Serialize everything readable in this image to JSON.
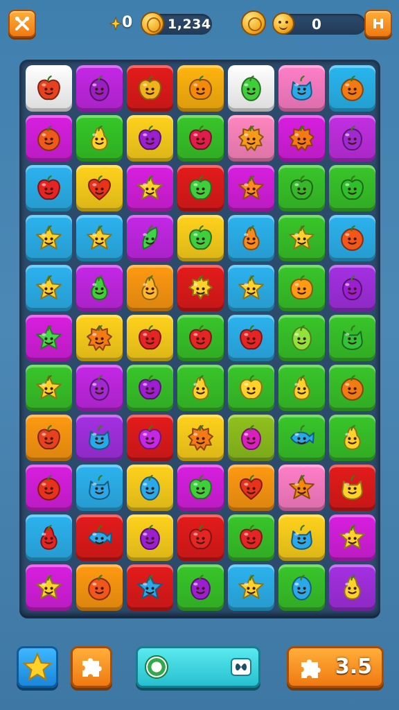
{
  "hud": {
    "menu_icon": "crossed-tools-icon",
    "star_counter": "0",
    "coin_balance": "1,234",
    "score_icon": "sun-badge-icon",
    "score_value": "0",
    "pause_icon": "pause-icon"
  },
  "board": {
    "columns": 7,
    "rows": 11,
    "tiles": [
      [
        {
          "c": "#ffffff",
          "f": "apple",
          "k": "#e8411f"
        },
        {
          "c": "#c428e6",
          "f": "plum",
          "k": "#9a1fc0"
        },
        {
          "c": "#e41b1b",
          "f": "apple",
          "k": "#f0b31c"
        },
        {
          "c": "#ffb40f",
          "f": "pumpkin",
          "k": "#f58a0a"
        },
        {
          "c": "#ffffff",
          "f": "lemon",
          "k": "#3fcf3c"
        },
        {
          "c": "#ff7fc8",
          "f": "cat",
          "k": "#2aa8ea"
        },
        {
          "c": "#29b6ef",
          "f": "orange",
          "k": "#f27a12"
        }
      ],
      [
        {
          "c": "#d81fe0",
          "f": "orange",
          "k": "#f05a18"
        },
        {
          "c": "#35c828",
          "f": "pear",
          "k": "#ffd22a"
        },
        {
          "c": "#ffd21c",
          "f": "apple",
          "k": "#9b1fd0"
        },
        {
          "c": "#39c62a",
          "f": "apple",
          "k": "#e01c4c"
        },
        {
          "c": "#ff86c0",
          "f": "flower",
          "k": "#f79a1a"
        },
        {
          "c": "#d81fe0",
          "f": "flower",
          "k": "#f57a14"
        },
        {
          "c": "#c32fe3",
          "f": "berry",
          "k": "#a02ad0"
        }
      ],
      [
        {
          "c": "#2cb3ef",
          "f": "apple",
          "k": "#e52424"
        },
        {
          "c": "#ffd21c",
          "f": "heart",
          "k": "#e8331c"
        },
        {
          "c": "#d81fe0",
          "f": "star",
          "k": "#ffd22a"
        },
        {
          "c": "#e41b1b",
          "f": "apple",
          "k": "#3fcf3c"
        },
        {
          "c": "#d81fe0",
          "f": "star",
          "k": "#ff8a1c"
        },
        {
          "c": "#39c62a",
          "f": "apple",
          "k": "#37b82a"
        },
        {
          "c": "#39c62a",
          "f": "apple",
          "k": "#2fbf2a"
        }
      ],
      [
        {
          "c": "#2cb3ef",
          "f": "star",
          "k": "#ffd22a"
        },
        {
          "c": "#2cb3ef",
          "f": "star",
          "k": "#ffd22a"
        },
        {
          "c": "#c428e6",
          "f": "leaf",
          "k": "#3fd24a"
        },
        {
          "c": "#ffd21c",
          "f": "apple",
          "k": "#3fcf3c"
        },
        {
          "c": "#2cb3ef",
          "f": "pear",
          "k": "#f78a1a"
        },
        {
          "c": "#39c62a",
          "f": "star",
          "k": "#ffd22a"
        },
        {
          "c": "#2cb3ef",
          "f": "orange",
          "k": "#f2561a"
        }
      ],
      [
        {
          "c": "#2cb3ef",
          "f": "star",
          "k": "#ffd22a"
        },
        {
          "c": "#c428e6",
          "f": "pear",
          "k": "#3fcf3c"
        },
        {
          "c": "#ff9a12",
          "f": "pear",
          "k": "#ffb82a"
        },
        {
          "c": "#e41b1b",
          "f": "sun",
          "k": "#ffd22a"
        },
        {
          "c": "#2cb3ef",
          "f": "star",
          "k": "#ffd22a"
        },
        {
          "c": "#39c62a",
          "f": "pumpkin",
          "k": "#ff9a12"
        },
        {
          "c": "#a430e3",
          "f": "berry",
          "k": "#9b1fd0"
        }
      ],
      [
        {
          "c": "#d81fe0",
          "f": "star",
          "k": "#47d84a"
        },
        {
          "c": "#ffd21c",
          "f": "flower",
          "k": "#f57a14"
        },
        {
          "c": "#ffd21c",
          "f": "apple",
          "k": "#e52424"
        },
        {
          "c": "#39c62a",
          "f": "apple",
          "k": "#e52424"
        },
        {
          "c": "#2cb3ef",
          "f": "apple",
          "k": "#e52424"
        },
        {
          "c": "#39c62a",
          "f": "lemon",
          "k": "#93e13a"
        },
        {
          "c": "#39c62a",
          "f": "cat",
          "k": "#33c23a"
        }
      ],
      [
        {
          "c": "#39c62a",
          "f": "star",
          "k": "#ffd22a"
        },
        {
          "c": "#c428e6",
          "f": "plum",
          "k": "#a02ad0"
        },
        {
          "c": "#39c62a",
          "f": "apple",
          "k": "#9b1fd0"
        },
        {
          "c": "#39c62a",
          "f": "pear",
          "k": "#ffd22a"
        },
        {
          "c": "#39c62a",
          "f": "apple",
          "k": "#ffd22a"
        },
        {
          "c": "#39c62a",
          "f": "pear",
          "k": "#ffd22a"
        },
        {
          "c": "#39c62a",
          "f": "orange",
          "k": "#f27a12"
        }
      ],
      [
        {
          "c": "#ff9a12",
          "f": "apple",
          "k": "#e8411f"
        },
        {
          "c": "#a430e3",
          "f": "cat",
          "k": "#2aa8ea"
        },
        {
          "c": "#e41b1b",
          "f": "apple",
          "k": "#c428e6"
        },
        {
          "c": "#ffd21c",
          "f": "flower",
          "k": "#f57a14"
        },
        {
          "c": "#8fc21e",
          "f": "berry",
          "k": "#d81fbf"
        },
        {
          "c": "#39c62a",
          "f": "fish",
          "k": "#2aa8ea"
        },
        {
          "c": "#39c62a",
          "f": "pear",
          "k": "#ffd22a"
        }
      ],
      [
        {
          "c": "#d81fe0",
          "f": "orange",
          "k": "#e8331c"
        },
        {
          "c": "#2cb3ef",
          "f": "cat",
          "k": "#2aa8ea"
        },
        {
          "c": "#ffd21c",
          "f": "lemon",
          "k": "#2aa8ea"
        },
        {
          "c": "#d81fe0",
          "f": "apple",
          "k": "#3fcf3c"
        },
        {
          "c": "#ff9a12",
          "f": "heart",
          "k": "#e8331c"
        },
        {
          "c": "#ff7fc8",
          "f": "star",
          "k": "#f58a0a"
        },
        {
          "c": "#e41b1b",
          "f": "cat",
          "k": "#ffd22a"
        }
      ],
      [
        {
          "c": "#2cb3ef",
          "f": "pear",
          "k": "#e52424"
        },
        {
          "c": "#e41b1b",
          "f": "fish",
          "k": "#2aa8ea"
        },
        {
          "c": "#ffd21c",
          "f": "berry",
          "k": "#9b1fd0"
        },
        {
          "c": "#e41b1b",
          "f": "apple",
          "k": "#e52424"
        },
        {
          "c": "#39c62a",
          "f": "apple",
          "k": "#e52424"
        },
        {
          "c": "#ffd21c",
          "f": "cat",
          "k": "#2aa8ea"
        },
        {
          "c": "#d81fe0",
          "f": "star",
          "k": "#ffd22a"
        }
      ],
      [
        {
          "c": "#d81fe0",
          "f": "star",
          "k": "#ffd22a"
        },
        {
          "c": "#ff9a12",
          "f": "orange",
          "k": "#f2561a"
        },
        {
          "c": "#e41b1b",
          "f": "star",
          "k": "#2aa8ea"
        },
        {
          "c": "#39c62a",
          "f": "berry",
          "k": "#9b1fd0"
        },
        {
          "c": "#2cb3ef",
          "f": "star",
          "k": "#ffd22a"
        },
        {
          "c": "#39c62a",
          "f": "lemon",
          "k": "#2aa8ea"
        },
        {
          "c": "#a430e3",
          "f": "pear",
          "k": "#ffd22a"
        }
      ]
    ]
  },
  "toolbar": {
    "star_booster_icon": "star-icon",
    "puzzle_booster_icon": "puzzle-piece-icon",
    "goal_icon": "target-icon",
    "goal_toggle_icon": "infinity-icon",
    "moves_icon": "puzzle-piece-icon",
    "moves_value": "3.5"
  },
  "colors": {
    "background": "#4583b2",
    "board": "#2c4b6c",
    "accent_orange": "#f07a12",
    "accent_blue": "#1b86d8",
    "accent_cyan": "#27bfd0"
  }
}
